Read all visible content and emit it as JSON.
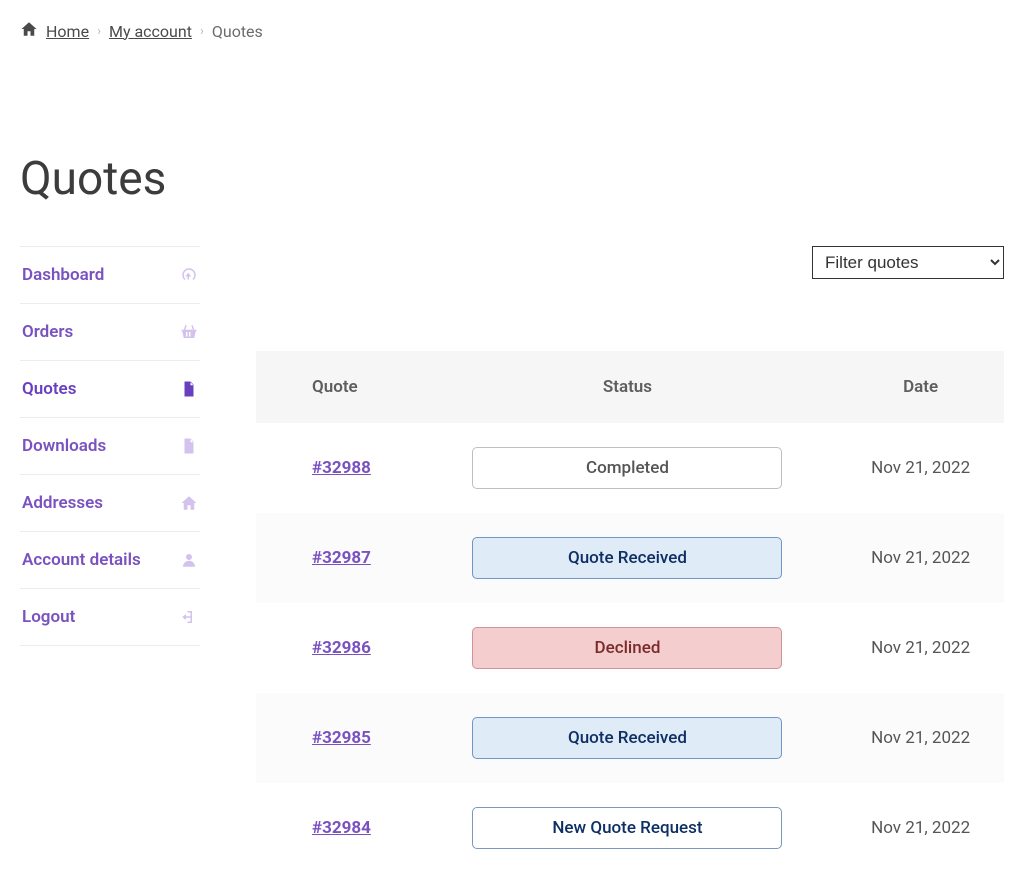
{
  "breadcrumb": {
    "home": "Home",
    "account": "My account",
    "current": "Quotes"
  },
  "page_title": "Quotes",
  "sidebar": {
    "items": [
      {
        "label": "Dashboard",
        "icon": "dashboard",
        "active": false
      },
      {
        "label": "Orders",
        "icon": "basket",
        "active": false
      },
      {
        "label": "Quotes",
        "icon": "file",
        "active": true
      },
      {
        "label": "Downloads",
        "icon": "download-file",
        "active": false
      },
      {
        "label": "Addresses",
        "icon": "home",
        "active": false
      },
      {
        "label": "Account details",
        "icon": "user",
        "active": false
      },
      {
        "label": "Logout",
        "icon": "logout",
        "active": false
      }
    ]
  },
  "filter": {
    "label": "Filter quotes"
  },
  "table": {
    "headers": {
      "quote": "Quote",
      "status": "Status",
      "date": "Date"
    },
    "rows": [
      {
        "id": "#32988",
        "status": "Completed",
        "status_class": "completed",
        "date": "Nov 21, 2022"
      },
      {
        "id": "#32987",
        "status": "Quote Received",
        "status_class": "received",
        "date": "Nov 21, 2022"
      },
      {
        "id": "#32986",
        "status": "Declined",
        "status_class": "declined",
        "date": "Nov 21, 2022"
      },
      {
        "id": "#32985",
        "status": "Quote Received",
        "status_class": "received",
        "date": "Nov 21, 2022"
      },
      {
        "id": "#32984",
        "status": "New Quote Request",
        "status_class": "new",
        "date": "Nov 21, 2022"
      }
    ]
  }
}
